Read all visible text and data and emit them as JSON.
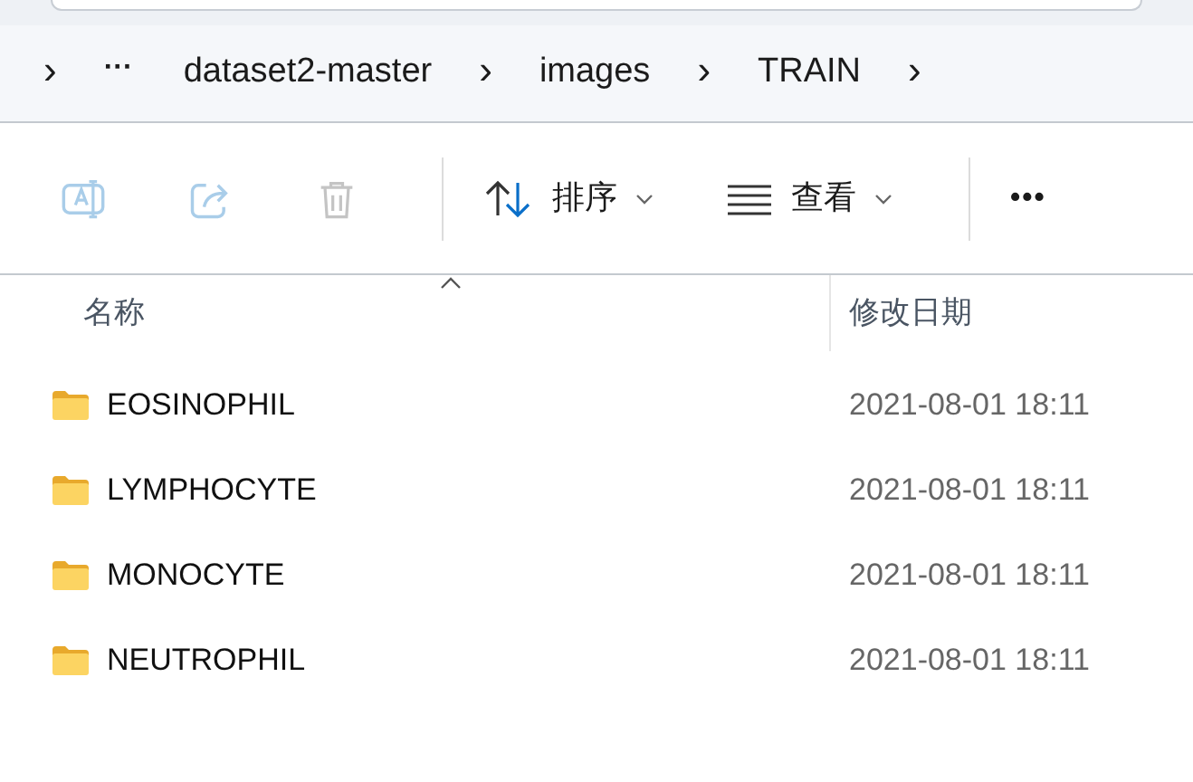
{
  "breadcrumb": {
    "items": [
      {
        "kind": "chevron",
        "label": "›"
      },
      {
        "kind": "more",
        "label": "···"
      },
      {
        "kind": "folder",
        "label": "dataset2-master"
      },
      {
        "kind": "chevron",
        "label": "›"
      },
      {
        "kind": "folder",
        "label": "images"
      },
      {
        "kind": "chevron",
        "label": "›"
      },
      {
        "kind": "folder",
        "label": "TRAIN"
      },
      {
        "kind": "chevron",
        "label": "›"
      }
    ]
  },
  "toolbar": {
    "items": [
      {
        "kind": "rename",
        "disabled": true
      },
      {
        "kind": "share",
        "disabled": true
      },
      {
        "kind": "delete",
        "disabled": true
      },
      {
        "kind": "separator"
      },
      {
        "kind": "sort",
        "label": "排序",
        "disabled": false
      },
      {
        "kind": "view",
        "label": "查看",
        "disabled": false
      },
      {
        "kind": "separator"
      },
      {
        "kind": "more",
        "label": "•••",
        "disabled": false
      }
    ]
  },
  "table": {
    "columns": [
      {
        "label": "名称",
        "sorted": true
      },
      {
        "label": "修改日期",
        "sorted": false
      }
    ],
    "rows": [
      {
        "name": "EOSINOPHIL",
        "modified": "2021-08-01 18:11"
      },
      {
        "name": "LYMPHOCYTE",
        "modified": "2021-08-01 18:11"
      },
      {
        "name": "MONOCYTE",
        "modified": "2021-08-01 18:11"
      },
      {
        "name": "NEUTROPHIL",
        "modified": "2021-08-01 18:11"
      }
    ]
  }
}
